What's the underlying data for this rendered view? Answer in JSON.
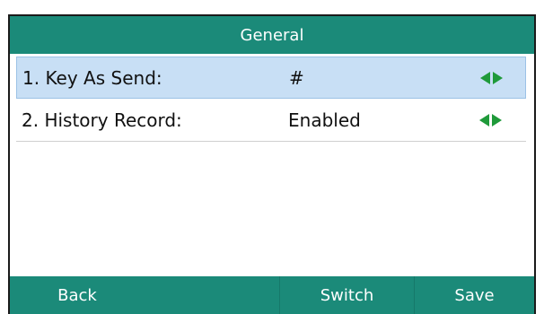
{
  "title": "General",
  "rows": [
    {
      "label": "1. Key As Send:",
      "value": "#",
      "selected": true
    },
    {
      "label": "2. History Record:",
      "value": "Enabled",
      "selected": false
    }
  ],
  "softkeys": {
    "back": "Back",
    "blank": "",
    "switch": "Switch",
    "save": "Save"
  },
  "colors": {
    "header": "#1b8a79",
    "selection": "#c8dff5",
    "arrows": "#1f9a3a"
  },
  "icons": {
    "value_arrows": [
      "arrow-left-icon",
      "arrow-right-icon"
    ]
  }
}
